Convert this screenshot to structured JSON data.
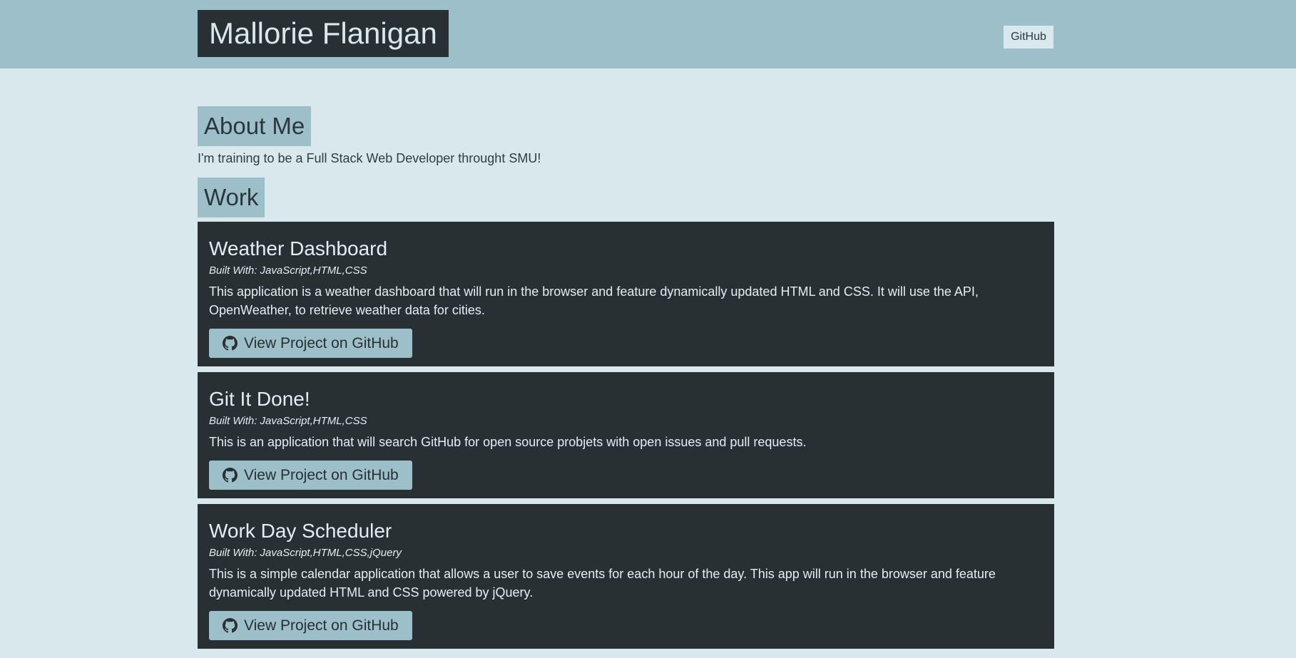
{
  "header": {
    "name": "Mallorie Flanigan",
    "nav_github": "GitHub"
  },
  "about": {
    "heading": "About Me",
    "text": "I'm training to be a Full Stack Web Developer throught SMU!"
  },
  "work": {
    "heading": "Work",
    "projects": [
      {
        "title": "Weather Dashboard",
        "built_with": "Built With: JavaScript,HTML,CSS",
        "description": "This application is a weather dashboard that will run in the browser and feature dynamically updated HTML and CSS. It will use the API, OpenWeather, to retrieve weather data for cities.",
        "button_label": "View Project on GitHub",
        "icon": "github-icon"
      },
      {
        "title": "Git It Done!",
        "built_with": "Built With: JavaScript,HTML,CSS",
        "description": "This is an application that will search GitHub for open source probjets with open issues and pull requests.",
        "button_label": "View Project on GitHub",
        "icon": "github-icon"
      },
      {
        "title": "Work Day Scheduler",
        "built_with": "Built With: JavaScript,HTML,CSS,jQuery",
        "description": "This is a simple calendar application that allows a user to save events for each hour of the day. This app will run in the browser and feature dynamically updated HTML and CSS powered by jQuery.",
        "button_label": "View Project on GitHub",
        "icon": "github-icon"
      }
    ]
  },
  "colors": {
    "page_bg": "#d8e8ed",
    "header_bg": "#9dbfca",
    "card_bg": "#283034",
    "accent": "#9dbfca"
  }
}
